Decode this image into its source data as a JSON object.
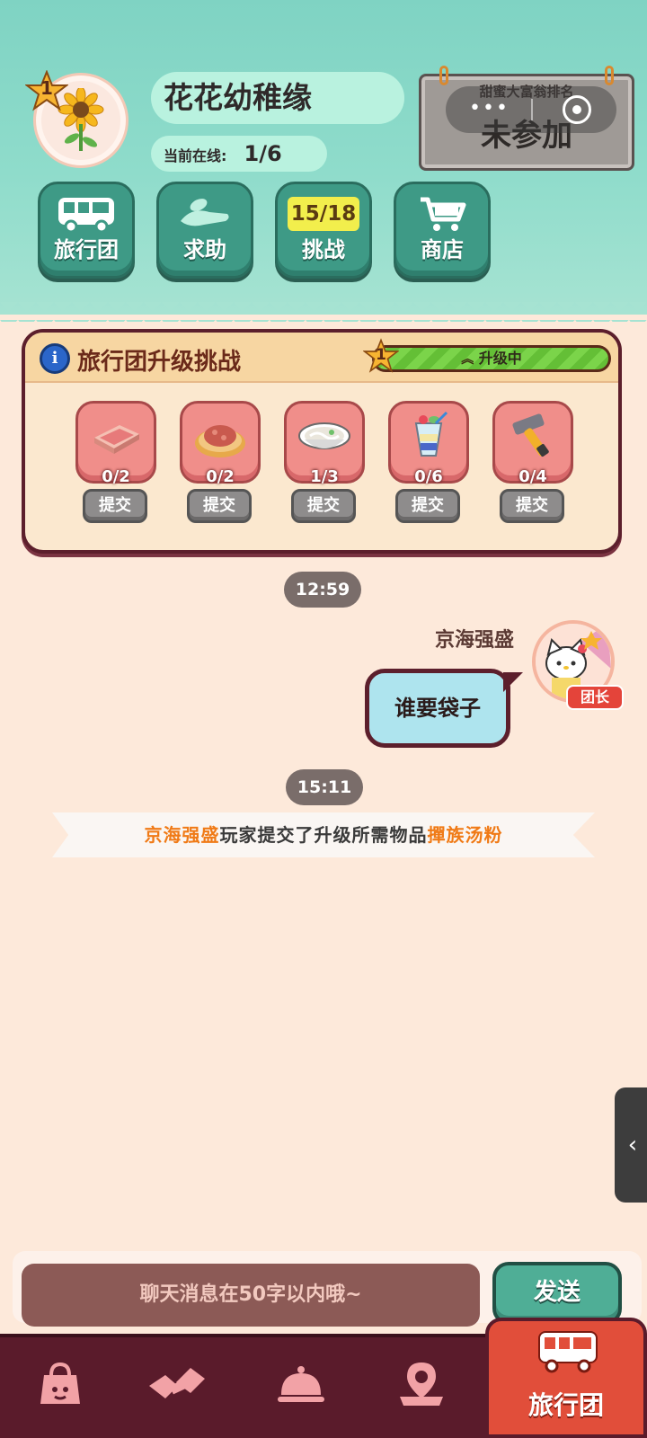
{
  "header": {
    "level": "1",
    "team_name": "花花幼稚缘",
    "online_label": "当前在线:",
    "online_value": "1/6",
    "rank_title": "甜蜜大富翁排名",
    "rank_status": "未参加"
  },
  "nav": [
    {
      "label": "旅行团",
      "icon": "bus-icon"
    },
    {
      "label": "求助",
      "icon": "help-hand-icon"
    },
    {
      "label": "挑战",
      "counter": "15/18"
    },
    {
      "label": "商店",
      "icon": "cart-icon"
    }
  ],
  "challenge": {
    "title": "旅行团升级挑战",
    "level": "1",
    "progress_label": "升级中",
    "progress_fraction": 1.0,
    "submit_label": "提交",
    "items": [
      {
        "name": "meat-item",
        "count": "0/2"
      },
      {
        "name": "pizza-item",
        "count": "0/2"
      },
      {
        "name": "noodle-soup-item",
        "count": "1/3"
      },
      {
        "name": "parfait-item",
        "count": "0/6"
      },
      {
        "name": "hammer-item",
        "count": "0/4"
      }
    ]
  },
  "chat": {
    "time1": "12:59",
    "sender": "京海强盛",
    "leader_badge": "团长",
    "message": "谁要袋子",
    "time2": "15:11",
    "system_player": "京海强盛",
    "system_text": "玩家提交了升级所需物品",
    "system_item": "撣族汤粉"
  },
  "input": {
    "placeholder": "聊天消息在50字以内哦~",
    "send_label": "发送"
  },
  "side_tab": "‹",
  "tabbar": {
    "active_label": "旅行团"
  },
  "colors": {
    "header_teal": "#8fdccb",
    "panel_border": "#5c1f2c",
    "highlight_orange": "#f07a16",
    "tabbar_bg": "#5a1b2b",
    "tab_active": "#e14e3a"
  }
}
